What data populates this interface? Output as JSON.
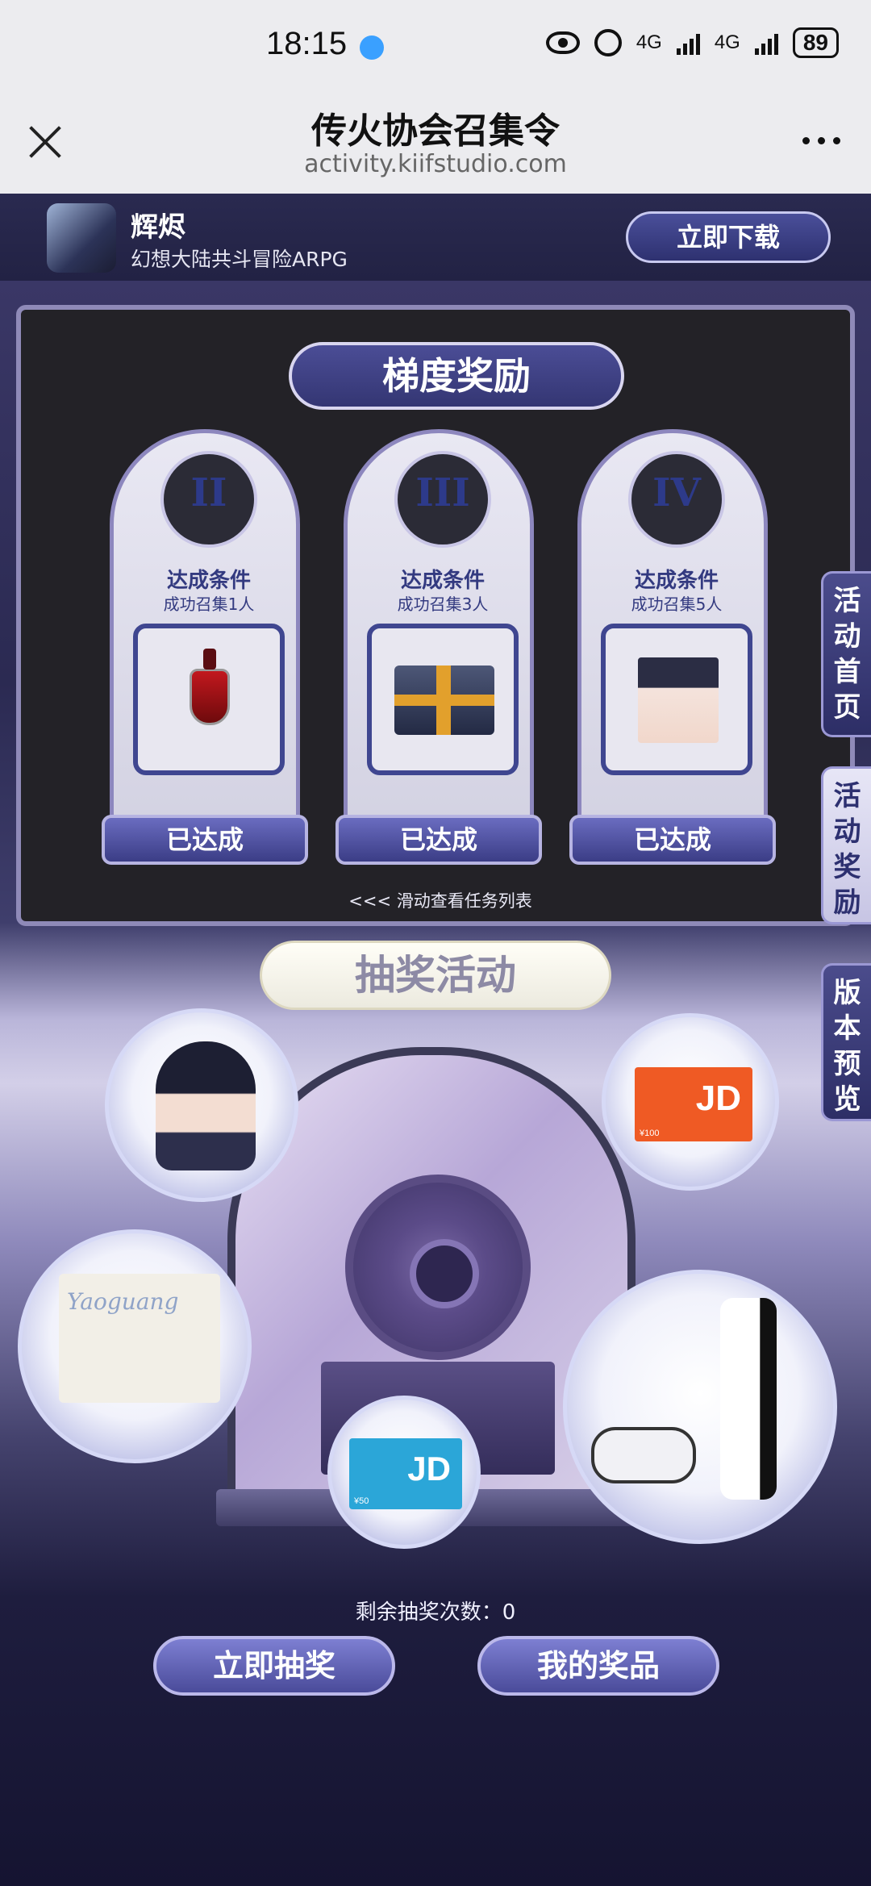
{
  "status_bar": {
    "time": "18:15",
    "network_1": "4G",
    "network_2": "4G",
    "battery": "89"
  },
  "nav": {
    "title": "传火协会召集令",
    "url": "activity.kiifstudio.com"
  },
  "app_banner": {
    "name": "辉烬",
    "description": "幻想大陆共斗冒险ARPG",
    "download_label": "立即下载"
  },
  "rewards": {
    "title": "梯度奖励",
    "tiers": [
      {
        "roman": "II",
        "cond_label": "达成条件",
        "cond_text": "成功召集1人",
        "status": "已达成",
        "item": "potion-icon"
      },
      {
        "roman": "III",
        "cond_label": "达成条件",
        "cond_text": "成功召集3人",
        "status": "已达成",
        "item": "gift-box-icon"
      },
      {
        "roman": "IV",
        "cond_label": "达成条件",
        "cond_text": "成功召集5人",
        "status": "已达成",
        "item": "character-avatar"
      }
    ],
    "swipe_hint": "<<< 滑动查看任务列表"
  },
  "side_tabs": [
    {
      "label": "活动首页",
      "active": false
    },
    {
      "label": "活动奖励",
      "active": true
    },
    {
      "label": "版本预览",
      "active": false
    }
  ],
  "lottery": {
    "title": "抽奖活动",
    "prizes": {
      "card_large": {
        "brand": "JD",
        "amount": "¥100"
      },
      "card_small": {
        "brand": "JD",
        "amount": "¥50"
      },
      "tote_text": "Yaoguang"
    },
    "remaining_label": "剩余抽奖次数：",
    "remaining_count": "0",
    "draw_label": "立即抽奖",
    "my_prizes_label": "我的奖品"
  },
  "colors": {
    "accent": "#4a4f9a",
    "jd_orange": "#ef5a24",
    "jd_blue": "#2ba6d8"
  }
}
